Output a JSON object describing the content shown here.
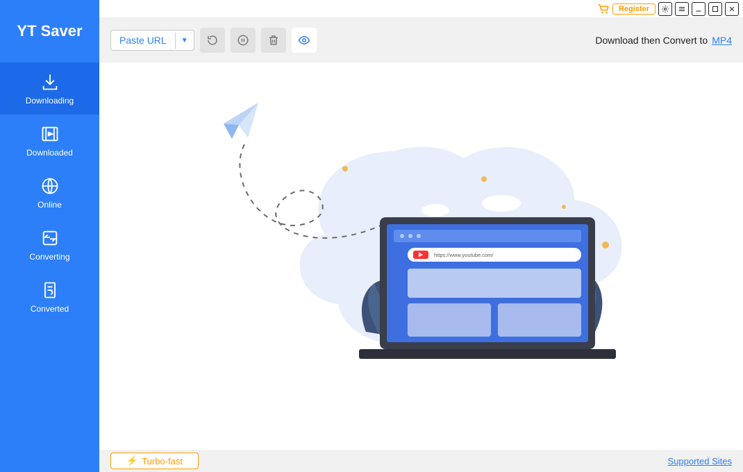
{
  "brand": {
    "title": "YT Saver"
  },
  "sidebar": {
    "items": [
      {
        "label": "Downloading"
      },
      {
        "label": "Downloaded"
      },
      {
        "label": "Online"
      },
      {
        "label": "Converting"
      },
      {
        "label": "Converted"
      }
    ]
  },
  "titlebar": {
    "register_label": "Register"
  },
  "toolbar": {
    "paste_label": "Paste URL",
    "convert_text": "Download then Convert to",
    "convert_format": "MP4"
  },
  "illustration": {
    "browser_url": "https://www.youtube.com/"
  },
  "statusbar": {
    "turbo_label": "Turbo-fast",
    "supported_sites": "Supported Sites"
  },
  "colors": {
    "primary": "#2d7ff9",
    "accent": "#ff9c00"
  }
}
